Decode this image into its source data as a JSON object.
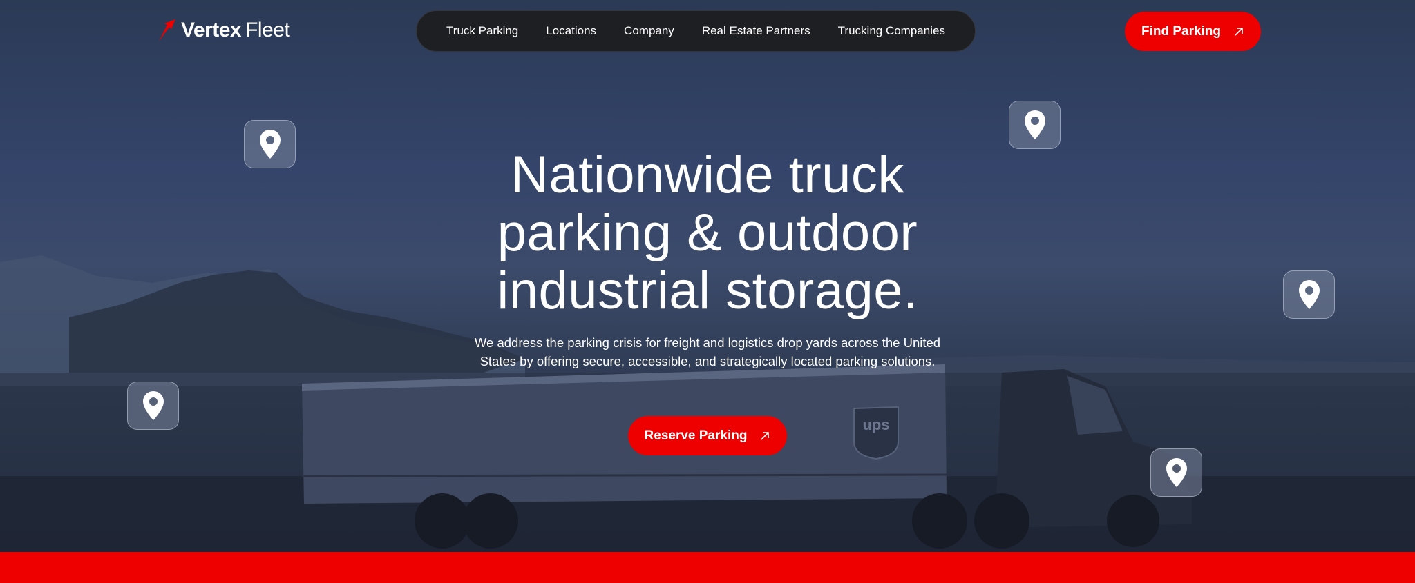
{
  "header": {
    "logo": {
      "bold": "Vertex",
      "light": "Fleet"
    },
    "nav": [
      {
        "label": "Truck Parking"
      },
      {
        "label": "Locations"
      },
      {
        "label": "Company"
      },
      {
        "label": "Real Estate Partners"
      },
      {
        "label": "Trucking Companies"
      }
    ],
    "cta_label": "Find Parking"
  },
  "hero": {
    "headline_lines": [
      "Nationwide truck",
      "parking & outdoor",
      "industrial storage."
    ],
    "subtext": "We address the parking crisis for freight and logistics drop yards across the United States by offering secure, accessible, and strategically located parking solutions.",
    "cta_label": "Reserve Parking",
    "truck_logo": "ups"
  },
  "icons": {
    "pin": "map-pin-icon",
    "arrow": "arrow-up-right-icon",
    "logo_mark": "logo-swoosh-icon"
  },
  "colors": {
    "accent": "#ee0000",
    "nav_bg": "#1e1f22",
    "hero_overlay": "#2f3d5a",
    "text": "#ffffff"
  }
}
